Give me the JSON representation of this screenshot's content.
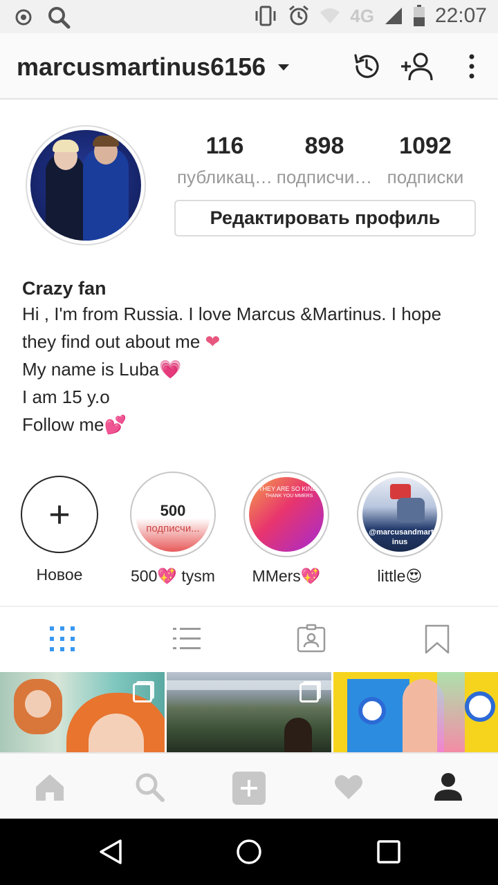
{
  "status_bar": {
    "network": "4G",
    "time": "22:07"
  },
  "header": {
    "username": "marcusmartinus6156",
    "icons": [
      "archive-history-icon",
      "discover-people-icon",
      "more-options-icon"
    ]
  },
  "profile": {
    "stats": [
      {
        "value": "116",
        "label": "публикац…"
      },
      {
        "value": "898",
        "label": "подписчи…"
      },
      {
        "value": "1092",
        "label": "подписки"
      }
    ],
    "edit_button": "Редактировать профиль"
  },
  "bio": {
    "name": "Crazy fan",
    "lines": [
      "Hi , I'm from Russia. I love Marcus &Martinus. I hope",
      "they find out about me",
      "My name is Luba",
      "I am 15 y.o",
      "Follow me"
    ]
  },
  "highlights": [
    {
      "label": "Новое"
    },
    {
      "label": "500💖 tysm",
      "cover_text_1": "500",
      "cover_text_2": "подписчи..."
    },
    {
      "label": "MMers💖",
      "cover_text_1": "THEY ARE SO KIND",
      "cover_text_2": "THANK YOU MMERS"
    },
    {
      "label": "little😍",
      "cover_text_1": "@marcusandmart",
      "cover_text_2": "inus"
    }
  ],
  "tabs": [
    "grid-view-icon",
    "list-view-icon",
    "tagged-photos-icon",
    "saved-bookmark-icon"
  ],
  "bottom_nav": [
    "home-icon",
    "search-icon",
    "new-post-icon",
    "activity-heart-icon",
    "profile-icon"
  ],
  "colors": {
    "accent_blue": "#3897f0",
    "heart_pink": "#e8577f",
    "text_primary": "#262626",
    "text_secondary": "#999999"
  }
}
